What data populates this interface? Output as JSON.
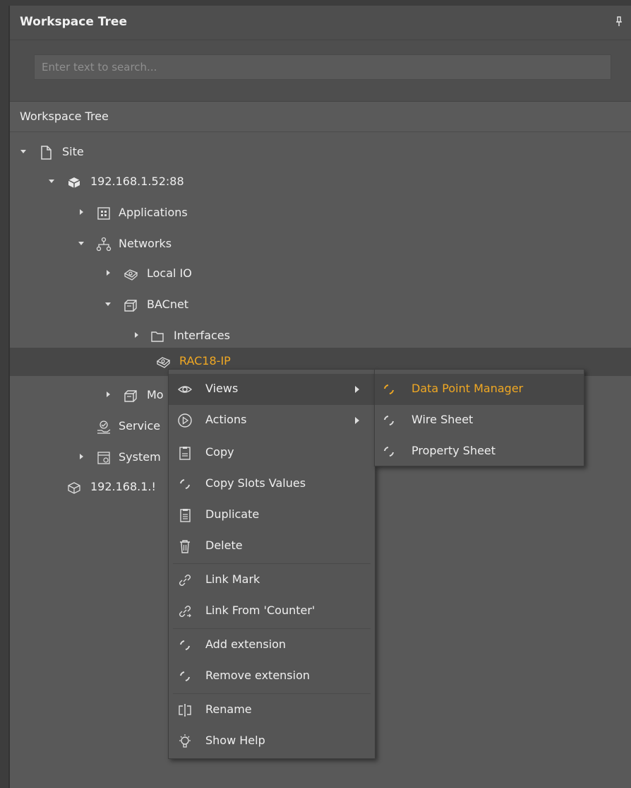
{
  "panel": {
    "title": "Workspace Tree",
    "pin_icon": "pin-icon"
  },
  "search": {
    "placeholder": "Enter text to search..."
  },
  "tree": {
    "header": "Workspace Tree",
    "nodes": [
      {
        "label": "Site",
        "icon": "file-icon",
        "state": "expanded"
      },
      {
        "label": "192.168.1.52:88",
        "icon": "device-icon",
        "state": "expanded"
      },
      {
        "label": "Applications",
        "icon": "applications-icon",
        "state": "collapsed"
      },
      {
        "label": "Networks",
        "icon": "networks-icon",
        "state": "expanded"
      },
      {
        "label": "Local IO",
        "icon": "local-io-icon",
        "state": "collapsed"
      },
      {
        "label": "BACnet",
        "icon": "bacnet-icon",
        "state": "expanded"
      },
      {
        "label": "Interfaces",
        "icon": "folder-icon",
        "state": "collapsed"
      },
      {
        "label": "RAC18-IP",
        "icon": "device-node-icon",
        "state": "selected"
      },
      {
        "label": "Mo",
        "icon": "modbus-icon",
        "state": "collapsed"
      },
      {
        "label": "Service",
        "icon": "services-icon",
        "state": "leaf"
      },
      {
        "label": "System",
        "icon": "system-icon",
        "state": "collapsed"
      },
      {
        "label": "192.168.1.!",
        "icon": "device-outline-icon",
        "state": "leaf"
      }
    ]
  },
  "context_menu": {
    "items": [
      {
        "label": "Views",
        "icon": "eye-icon",
        "submenu": true
      },
      {
        "label": "Actions",
        "icon": "play-circle-icon",
        "submenu": true
      },
      {
        "label": "Copy",
        "icon": "copy-icon"
      },
      {
        "label": "Copy Slots Values",
        "icon": "loading-icon"
      },
      {
        "label": "Duplicate",
        "icon": "duplicate-icon"
      },
      {
        "label": "Delete",
        "icon": "trash-icon"
      },
      {
        "label": "Link Mark",
        "icon": "link-icon"
      },
      {
        "label": "Link From 'Counter'",
        "icon": "link-from-icon"
      },
      {
        "label": "Add extension",
        "icon": "loading-icon"
      },
      {
        "label": "Remove extension",
        "icon": "loading-icon"
      },
      {
        "label": "Rename",
        "icon": "rename-icon"
      },
      {
        "label": "Show Help",
        "icon": "lightbulb-icon"
      }
    ]
  },
  "views_submenu": {
    "items": [
      {
        "label": "Data Point Manager",
        "icon": "loading-icon"
      },
      {
        "label": "Wire Sheet",
        "icon": "loading-icon"
      },
      {
        "label": "Property Sheet",
        "icon": "loading-icon"
      }
    ]
  },
  "colors": {
    "accent": "#f0a823",
    "panel_bg": "#595959",
    "menu_bg": "#555555",
    "hover_bg": "#474747"
  }
}
